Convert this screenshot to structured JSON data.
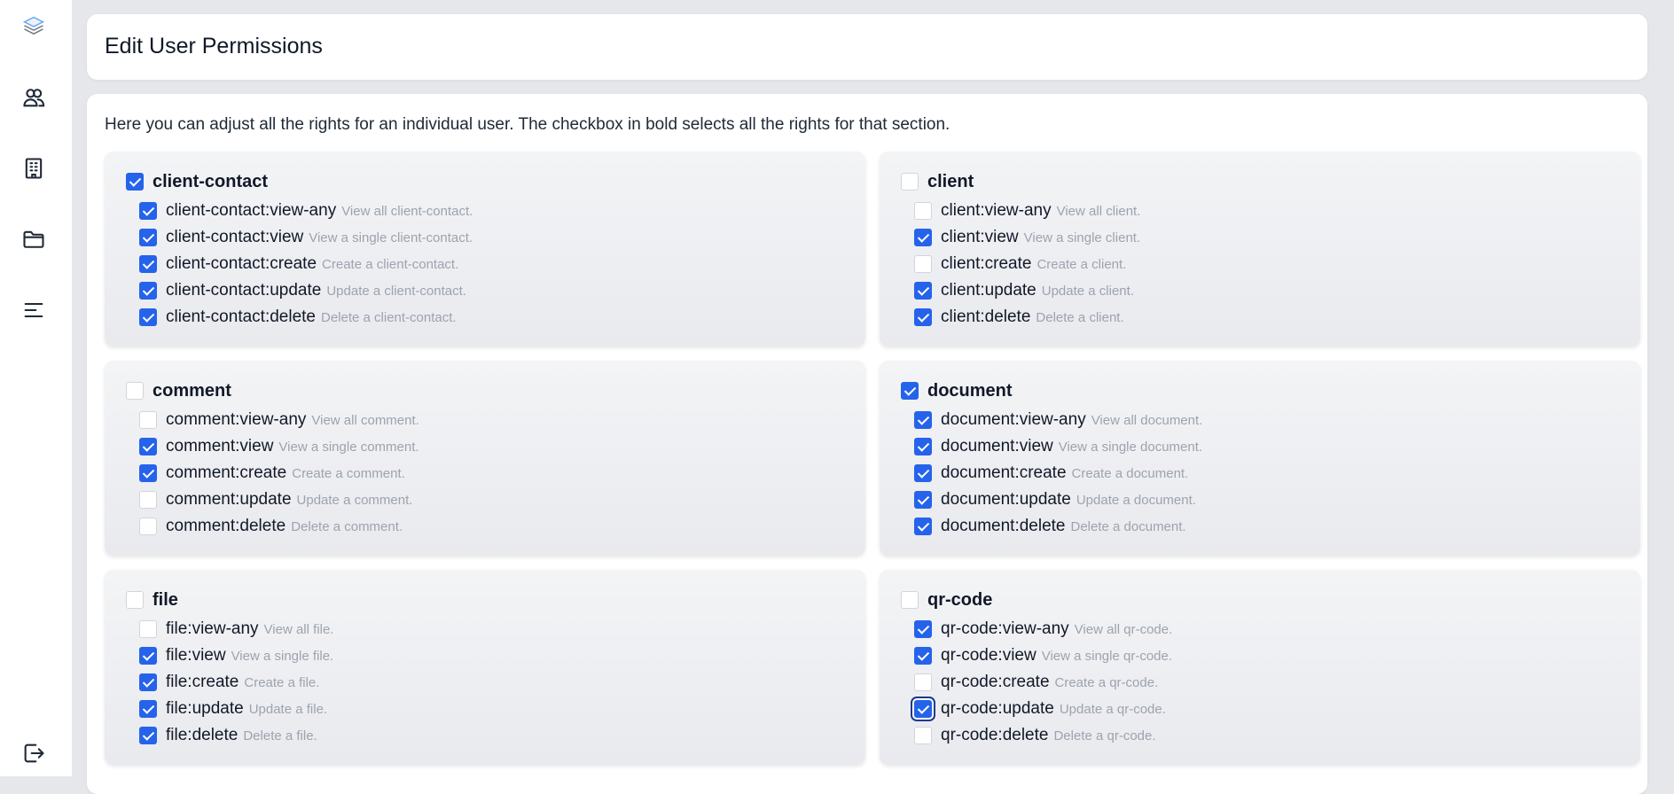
{
  "page": {
    "title": "Edit User Permissions",
    "intro": "Here you can adjust all the rights for an individual user. The checkbox in bold selects all the rights for that section."
  },
  "sidebar": {
    "icons": [
      "layers-logo-icon",
      "users-icon",
      "building-icon",
      "folder-icon",
      "menu-lines-icon"
    ],
    "bottom_icon": "logout-icon"
  },
  "colors": {
    "accent": "#2563eb",
    "background": "#e5e7eb",
    "card": "#ffffff",
    "muted_text": "#9ca3af"
  },
  "sections": [
    {
      "name": "client-contact",
      "checked": true,
      "perms": [
        {
          "label": "client-contact:view-any",
          "desc": "View all client-contact.",
          "checked": true
        },
        {
          "label": "client-contact:view",
          "desc": "View a single client-contact.",
          "checked": true
        },
        {
          "label": "client-contact:create",
          "desc": "Create a client-contact.",
          "checked": true
        },
        {
          "label": "client-contact:update",
          "desc": "Update a client-contact.",
          "checked": true
        },
        {
          "label": "client-contact:delete",
          "desc": "Delete a client-contact.",
          "checked": true
        }
      ]
    },
    {
      "name": "client",
      "checked": false,
      "perms": [
        {
          "label": "client:view-any",
          "desc": "View all client.",
          "checked": false
        },
        {
          "label": "client:view",
          "desc": "View a single client.",
          "checked": true
        },
        {
          "label": "client:create",
          "desc": "Create a client.",
          "checked": false
        },
        {
          "label": "client:update",
          "desc": "Update a client.",
          "checked": true
        },
        {
          "label": "client:delete",
          "desc": "Delete a client.",
          "checked": true
        }
      ]
    },
    {
      "name": "comment",
      "checked": false,
      "perms": [
        {
          "label": "comment:view-any",
          "desc": "View all comment.",
          "checked": false
        },
        {
          "label": "comment:view",
          "desc": "View a single comment.",
          "checked": true
        },
        {
          "label": "comment:create",
          "desc": "Create a comment.",
          "checked": true
        },
        {
          "label": "comment:update",
          "desc": "Update a comment.",
          "checked": false
        },
        {
          "label": "comment:delete",
          "desc": "Delete a comment.",
          "checked": false
        }
      ]
    },
    {
      "name": "document",
      "checked": true,
      "perms": [
        {
          "label": "document:view-any",
          "desc": "View all document.",
          "checked": true
        },
        {
          "label": "document:view",
          "desc": "View a single document.",
          "checked": true
        },
        {
          "label": "document:create",
          "desc": "Create a document.",
          "checked": true
        },
        {
          "label": "document:update",
          "desc": "Update a document.",
          "checked": true
        },
        {
          "label": "document:delete",
          "desc": "Delete a document.",
          "checked": true
        }
      ]
    },
    {
      "name": "file",
      "checked": false,
      "perms": [
        {
          "label": "file:view-any",
          "desc": "View all file.",
          "checked": false
        },
        {
          "label": "file:view",
          "desc": "View a single file.",
          "checked": true
        },
        {
          "label": "file:create",
          "desc": "Create a file.",
          "checked": true
        },
        {
          "label": "file:update",
          "desc": "Update a file.",
          "checked": true
        },
        {
          "label": "file:delete",
          "desc": "Delete a file.",
          "checked": true
        }
      ]
    },
    {
      "name": "qr-code",
      "checked": false,
      "perms": [
        {
          "label": "qr-code:view-any",
          "desc": "View all qr-code.",
          "checked": true
        },
        {
          "label": "qr-code:view",
          "desc": "View a single qr-code.",
          "checked": true
        },
        {
          "label": "qr-code:create",
          "desc": "Create a qr-code.",
          "checked": false
        },
        {
          "label": "qr-code:update",
          "desc": "Update a qr-code.",
          "checked": true,
          "focused": true
        },
        {
          "label": "qr-code:delete",
          "desc": "Delete a qr-code.",
          "checked": false
        }
      ]
    }
  ]
}
